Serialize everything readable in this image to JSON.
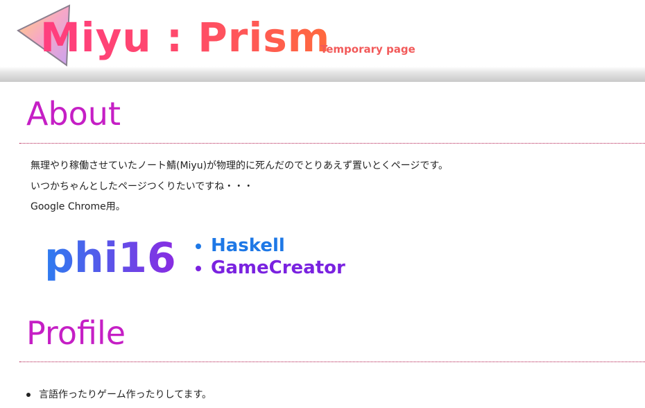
{
  "header": {
    "title": "Miyu : Prism",
    "subtitle": "Temporary page",
    "logo_icon": "triangle-logo-icon",
    "title_gradient": [
      "#ff3d7f",
      "#ff6a3d"
    ],
    "subtitle_color": "#f25a5a"
  },
  "about": {
    "heading": "About",
    "lines": [
      "無理やり稼働させていたノート鯖(Miyu)が物理的に死んだのでとりあえず置いとくページです。",
      "いつかちゃんとしたページつくりたいですね・・・",
      "Google Chrome用。"
    ],
    "banner": {
      "name": "phi16",
      "links": [
        "Haskell",
        "GameCreator"
      ],
      "link_colors": [
        "#1e78e6",
        "#7a22e0"
      ]
    }
  },
  "profile": {
    "heading": "Profile",
    "items": [
      "言語作ったりゲーム作ったりしてます。"
    ]
  },
  "colors": {
    "heading": "#c51fc5",
    "divider": "#b0164a",
    "text": "#222222"
  }
}
